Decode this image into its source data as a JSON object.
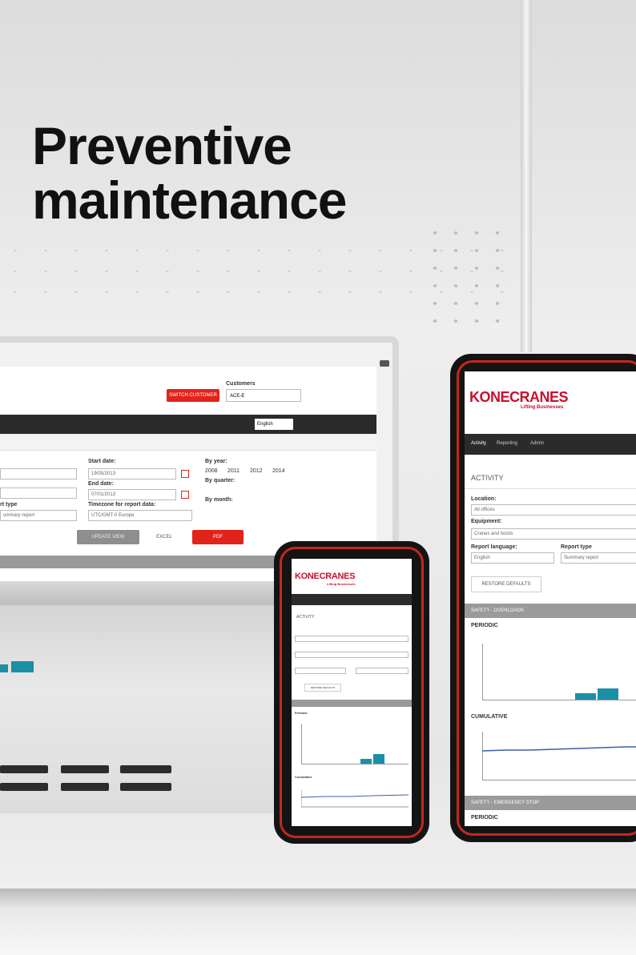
{
  "headline": {
    "line1": "Preventive",
    "line2": "maintenance"
  },
  "brand": {
    "name": "KONECRANES",
    "tagline": "Lifting Businesses",
    "color": "#c8102e"
  },
  "colors": {
    "accent_red": "#e2231a",
    "chart_teal": "#1a8fa6",
    "nav_dark": "#2b2b2b"
  },
  "laptop": {
    "customer_label": "Customers",
    "customer_select": "ACE-E",
    "red_button": "SWITCH CUSTOMER",
    "language": "English",
    "form": {
      "start_date_label": "Start date:",
      "start_date": "19/05/2013",
      "end_date_label": "End date:",
      "end_date": "07/01/2013",
      "timezone_label": "Timezone for report data:",
      "timezone": "UTC/GMT-0 Europe",
      "type_label": "rt type",
      "type_value": "ummary report",
      "by_year_label": "By year:",
      "years": [
        "2008",
        "2011",
        "2012",
        "2014"
      ],
      "by_quarter_label": "By quarter:",
      "by_month_label": "By month:"
    },
    "buttons": {
      "update": "UPDATE VIEW",
      "excel": "EXCEL",
      "pdf": "PDF"
    }
  },
  "tablet": {
    "nav": [
      "Activity",
      "Reporting",
      "Admin"
    ],
    "section_title": "ACTIVITY",
    "location_label": "Location:",
    "location_value": "All offices",
    "equipment_label": "Equipment:",
    "equipment_value": "Cranes and hoists",
    "language_label": "Report language:",
    "language_value": "English",
    "type_label": "Report type",
    "type_value": "Summary report",
    "restore_button": "RESTORE DEFAULTS",
    "safety_heading": "SAFETY - OVERLOADS",
    "periodic_label": "PERIODIC",
    "cumulative_label": "CUMULATIVE",
    "emergency_heading": "SAFETY - EMERGENCY STOP",
    "periodic2_label": "PERIODIC"
  },
  "phone": {
    "section_title": "ACTIVITY",
    "restore_button": "RESTORE DEFAULTS",
    "periodic_label": "Periodic",
    "cumulative_label": "Cumulative"
  }
}
